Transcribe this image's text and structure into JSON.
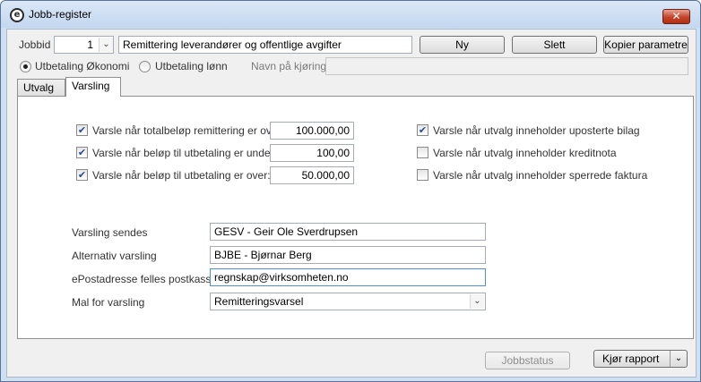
{
  "window": {
    "title": "Jobb-register",
    "close_label": "✕"
  },
  "header": {
    "jobbid_label": "Jobbid",
    "jobbid_value": "1",
    "description": "Remittering leverandører og offentlige avgifter",
    "ny_label": "Ny",
    "slett_label": "Slett",
    "kopier_label": "Kopier parametre",
    "radio_okonomi": "Utbetaling Økonomi",
    "radio_lonn": "Utbetaling lønn",
    "navn_label": "Navn på kjøring",
    "navn_value": ""
  },
  "tabs": [
    {
      "label": "Utvalg"
    },
    {
      "label": "Varsling"
    }
  ],
  "varsling": {
    "checks_left": [
      {
        "label": "Varsle når totalbeløp remittering er over:",
        "value": "100.000,00",
        "checked": true
      },
      {
        "label": "Varsle når beløp til utbetaling er under:",
        "value": "100,00",
        "checked": true
      },
      {
        "label": "Varsle når beløp til utbetaling er over:",
        "value": "50.000,00",
        "checked": true
      }
    ],
    "checks_right": [
      {
        "label": "Varsle når utvalg inneholder uposterte bilag",
        "checked": true
      },
      {
        "label": "Varsle når utvalg inneholder kreditnota",
        "checked": false
      },
      {
        "label": "Varsle når utvalg inneholder sperrede faktura",
        "checked": false
      }
    ],
    "sendes_label": "Varsling sendes",
    "sendes_value": "GESV - Geir Ole Sverdrupsen",
    "alternativ_label": "Alternativ varsling",
    "alternativ_value": "BJBE - Bjørnar Berg",
    "epost_label": "ePostadresse felles postkasse",
    "epost_value": "regnskap@virksomheten.no",
    "mal_label": "Mal for varsling",
    "mal_value": "Remitteringsvarsel"
  },
  "footer": {
    "jobbstatus_label": "Jobbstatus",
    "kjor_label": "Kjør rapport"
  },
  "icons": {
    "check": "✔",
    "dropdown": "⌄"
  }
}
